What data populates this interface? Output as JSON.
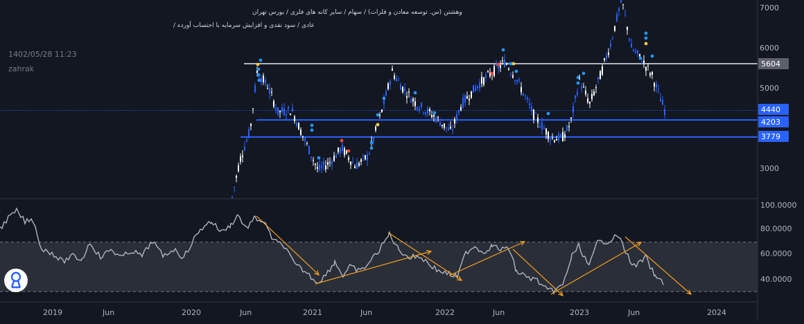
{
  "header": {
    "title_line1": "وهشتن (س. توسعه معادن و فلزات) / سهام / سایر کانه های فلزی / بورس تهران",
    "title_line2": "عادی / سود نقدی و افزایش سرمایه با احتساب آورده /",
    "datetime": "1402/05/28 11:23",
    "symbol": "zahrak"
  },
  "price_axis": {
    "ticks": [
      "7000",
      "6000",
      "5000",
      "3000"
    ],
    "labels": [
      {
        "text": "5604",
        "value": 5604,
        "color": "#d1d4dc",
        "bg": "#5d606b"
      },
      {
        "text": "4440",
        "value": 4440,
        "color": "#ffffff",
        "bg": "#2962ff"
      },
      {
        "text": "4203",
        "value": 4203,
        "color": "#ffffff",
        "bg": "#2962ff"
      },
      {
        "text": "3779",
        "value": 3779,
        "color": "#ffffff",
        "bg": "#2962ff"
      }
    ],
    "horizontal_lines": [
      {
        "value": 5604,
        "color": "#b2b5be"
      },
      {
        "value": 4203,
        "color": "#2962ff"
      },
      {
        "value": 3779,
        "color": "#2962ff"
      }
    ],
    "last_price": 4440
  },
  "indicator_axis": {
    "ticks": [
      "100.0000",
      "80.0000",
      "60.0000",
      "40.0000"
    ],
    "band_upper": 70,
    "band_lower": 30
  },
  "time_axis": {
    "labels": [
      "2019",
      "Jun",
      "2020",
      "Jun",
      "2021",
      "Jun",
      "2022",
      "Jun",
      "2023",
      "Jun",
      "2024"
    ]
  },
  "colors": {
    "background": "#131722",
    "up_candle": "#2962ff",
    "down_candle": "#ffffff",
    "trendline": "#f7a11c",
    "indicator_line": "#b2b5be",
    "band_fill": "#2a2e39"
  },
  "logo": {
    "icon": "tradingview-logo-icon"
  }
}
